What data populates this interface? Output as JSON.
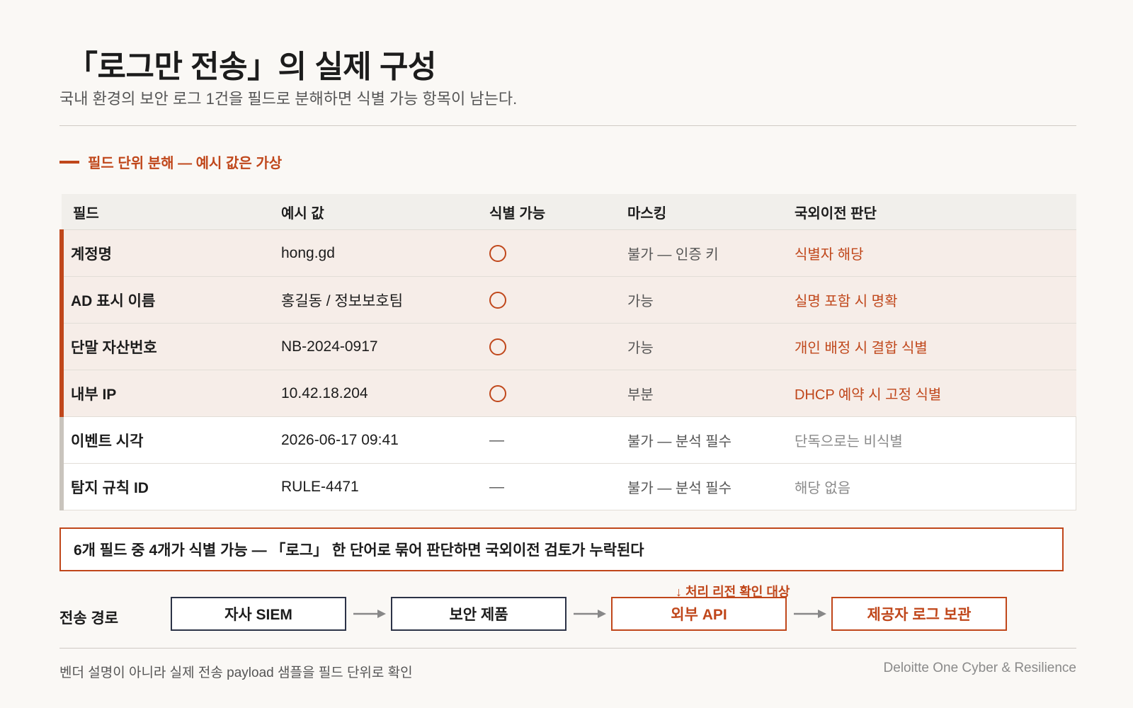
{
  "header": {
    "title": "「로그만 전송」의 실제 구성",
    "subtitle": "국내 환경의 보안 로그 1건을 필드로 분해하면 식별 가능 항목이 남는다."
  },
  "section": {
    "label": "필드 단위 분해 — 예시 값은 가상"
  },
  "table": {
    "columns": [
      "필드",
      "예시 값",
      "식별 가능",
      "마스킹",
      "국외이전 판단"
    ],
    "rows": [
      {
        "field": "계정명",
        "example": "hong.gd",
        "identifiable_icon": "circle-icon",
        "masking": "불가 — 인증 키",
        "judgment": "식별자 해당"
      },
      {
        "field": "AD 표시 이름",
        "example": "홍길동 / 정보보호팀",
        "identifiable_icon": "circle-icon",
        "masking": "가능",
        "judgment": "실명 포함 시 명확"
      },
      {
        "field": "단말 자산번호",
        "example": "NB-2024-0917",
        "identifiable_icon": "circle-icon",
        "masking": "가능",
        "judgment": "개인 배정 시 결합 식별"
      },
      {
        "field": "내부 IP",
        "example": "10.42.18.204",
        "identifiable_icon": "circle-icon",
        "masking": "부분",
        "judgment": "DHCP 예약 시 고정 식별"
      },
      {
        "field": "이벤트 시각",
        "example": "2026-06-17 09:41",
        "identifiable": "—",
        "masking": "불가 — 분석 필수",
        "judgment": "단독으로는 비식별"
      },
      {
        "field": "탐지 규칙 ID",
        "example": "RULE-4471",
        "identifiable": "—",
        "masking": "불가 — 분석 필수",
        "judgment": "해당 없음"
      }
    ]
  },
  "callout": {
    "text": "6개 필드 중 4개가 식별 가능 — 「로그」 한 단어로 묶어 판단하면 국외이전 검토가 누락된다"
  },
  "route": {
    "label": "전송 경로",
    "note": "↓ 처리 리전 확인 대상",
    "nodes": [
      "자사 SIEM",
      "보안 제품",
      "외부 API",
      "제공자 로그 보관"
    ]
  },
  "footer": {
    "left": "벤더 설명이 아니라 실제 전송 payload 샘플을 필드 단위로 확인",
    "right": "Deloitte One Cyber & Resilience"
  },
  "colors": {
    "accent": "#c0471b",
    "node_border": "#2c3347",
    "highlight_row": "#f6ede8"
  }
}
